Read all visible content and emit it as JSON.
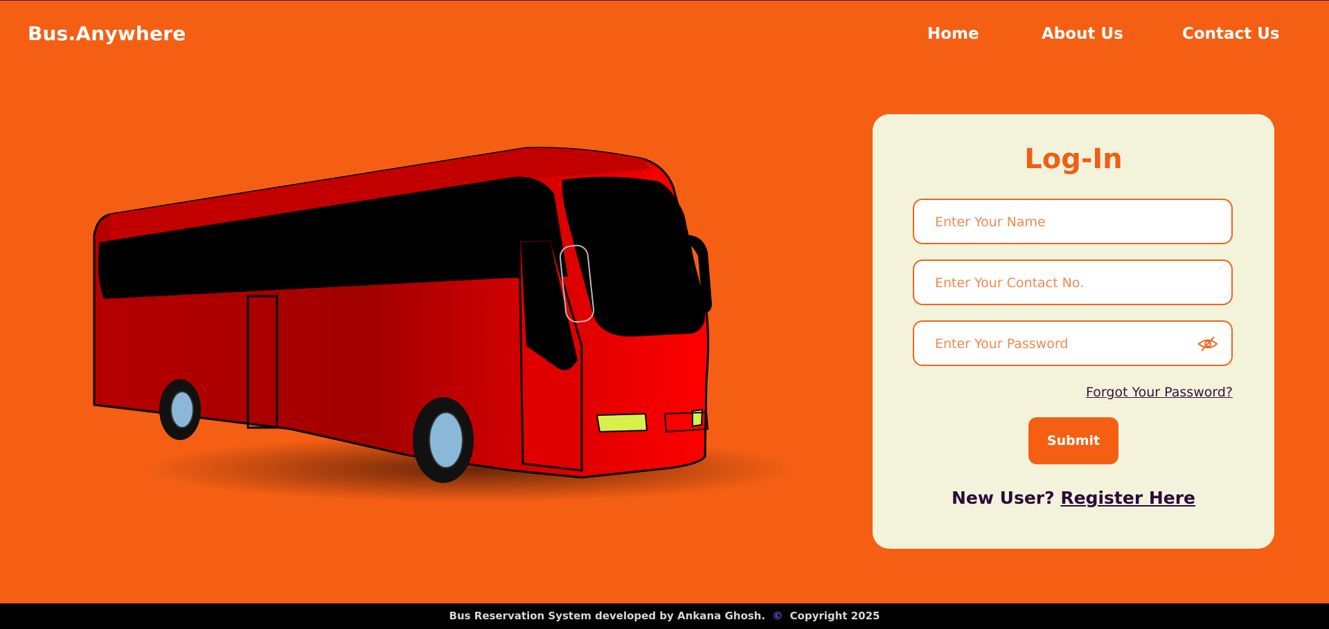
{
  "brand": "Bus.Anywhere",
  "nav": {
    "home": "Home",
    "about": "About Us",
    "contact": "Contact Us"
  },
  "login": {
    "title": "Log-In",
    "name_placeholder": "Enter Your Name",
    "contact_placeholder": "Enter Your Contact No.",
    "password_placeholder": "Enter Your Password",
    "forgot": "Forgot Your Password?",
    "submit": "Submit",
    "new_user": "New User?",
    "register": "Register Here"
  },
  "footer": {
    "text": "Bus Reservation System developed by Ankana Ghosh.",
    "copyright_symbol": "©",
    "copyright": "Copyright 2025"
  },
  "colors": {
    "background": "#f55f14",
    "card": "#f3f3dc",
    "accent": "#ee5f15",
    "footer": "#000000"
  },
  "icons": {
    "password_toggle": "eye-slash-icon"
  }
}
